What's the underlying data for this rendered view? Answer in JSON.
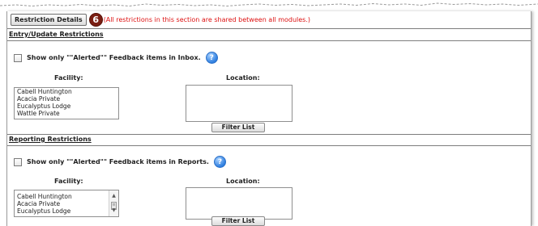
{
  "header": {
    "button_label": "Restriction Details",
    "callout_number": "6",
    "notice": "(All restrictions in this section are shared between all modules.)"
  },
  "entry_section": {
    "title": "Entry/Update Restrictions",
    "checkbox_label": "Show only \"\"Alerted\"\" Feedback items in Inbox.",
    "help_glyph": "?",
    "facility_label": "Facility:",
    "location_label": "Location:",
    "facilities": [
      "Cabell Huntington",
      "Acacia Private",
      "Eucalyptus Lodge",
      "Wattle Private"
    ],
    "filter_button": "Filter List"
  },
  "reporting_section": {
    "title": "Reporting Restrictions",
    "checkbox_label": "Show only \"\"Alerted\"\" Feedback items in Reports.",
    "help_glyph": "?",
    "facility_label": "Facility:",
    "location_label": "Location:",
    "facilities": [
      "Cabell Huntington",
      "Acacia Private",
      "Eucalyptus Lodge"
    ],
    "filter_button": "Filter List"
  },
  "colors": {
    "notice_red": "#dd1111",
    "callout_bg": "#7a1e12",
    "help_blue": "#2f7fe0"
  },
  "icons": {
    "callout": "numbered-callout-icon",
    "help": "help-icon",
    "scroll_up": "scroll-up-arrow-icon",
    "scroll_down": "scroll-down-arrow-icon"
  }
}
